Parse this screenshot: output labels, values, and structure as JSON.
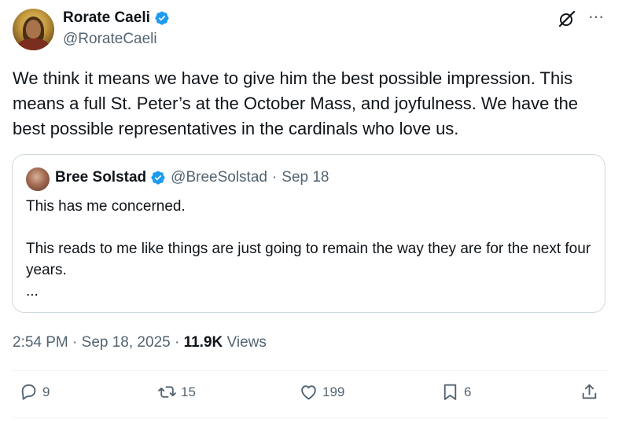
{
  "author": {
    "name": "Rorate Caeli",
    "handle": "@RorateCaeli"
  },
  "tweet": {
    "text": "We think it means we have to give him the best possible impression. This means a full St. Peter’s at the October Mass, and joyfulness. We have the best possible representatives in the cardinals who love us."
  },
  "quote": {
    "name": "Bree Solstad",
    "handle": "@BreeSolstad",
    "sep": "·",
    "date": "Sep 18",
    "text": "This has me concerned.\n\nThis reads to me like things are just going to remain the way they are for the next four years.\n..."
  },
  "meta": {
    "time": "2:54 PM",
    "sep1": "·",
    "date": "Sep 18, 2025",
    "sep2": "·",
    "views_count": "11.9K",
    "views_label": "Views"
  },
  "actions": {
    "replies": "9",
    "reposts": "15",
    "likes": "199",
    "bookmarks": "6"
  },
  "colors": {
    "text": "#0f1419",
    "secondary": "#536471",
    "verified": "#1d9bf0",
    "border": "#cfd9de"
  },
  "icons": [
    "verified-badge-icon",
    "grok-icon",
    "more-icon",
    "reply-icon",
    "repost-icon",
    "like-icon",
    "bookmark-icon",
    "share-icon"
  ]
}
